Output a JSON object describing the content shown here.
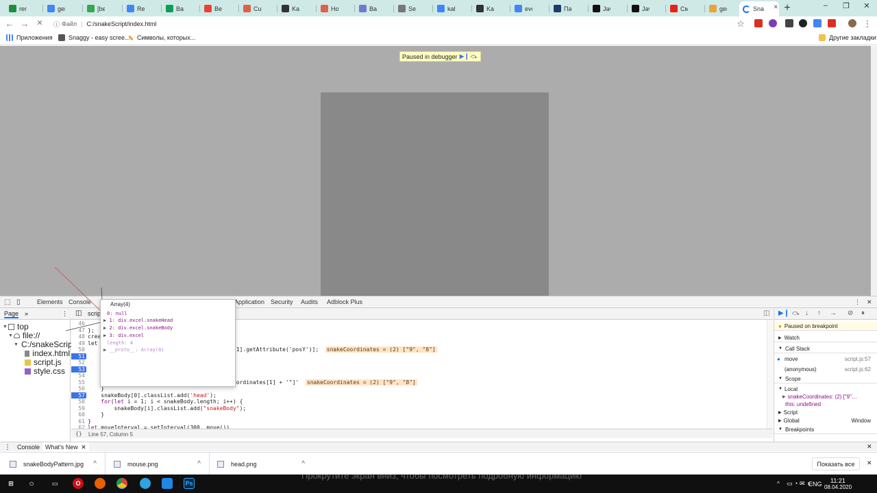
{
  "browser": {
    "tabs": [
      {
        "label": "rem",
        "color": "#1e8e3e"
      },
      {
        "label": "ger",
        "color": "#4285f4"
      },
      {
        "label": "[bet",
        "color": "#34a853"
      },
      {
        "label": "Rea",
        "color": "#4285f4"
      },
      {
        "label": "Bak",
        "color": "#0f9d58"
      },
      {
        "label": "Bes",
        "color": "#e94235"
      },
      {
        "label": "Cur",
        "color": "#e0604a"
      },
      {
        "label": "Kak",
        "color": "#333333"
      },
      {
        "label": "Hov",
        "color": "#e0604a"
      },
      {
        "label": "Bak",
        "color": "#6c7dd1"
      },
      {
        "label": "Ses",
        "color": "#777777"
      },
      {
        "label": "kak",
        "color": "#4285f4"
      },
      {
        "label": "Kak",
        "color": "#333333"
      },
      {
        "label": "eve",
        "color": "#4285f4"
      },
      {
        "label": "Пар",
        "color": "#1a3d6b"
      },
      {
        "label": "Jav",
        "color": "#111111"
      },
      {
        "label": "Jav",
        "color": "#111111"
      },
      {
        "label": "Сме",
        "color": "#e62117"
      },
      {
        "label": "gec",
        "color": "#e8a33d"
      }
    ],
    "active_tab": "Sna",
    "new_tab_symbol": "+",
    "window_controls": [
      "–",
      "❐",
      "✕"
    ],
    "address_prefix": "Файл",
    "address": "C:/snakeScript/index.html",
    "bookmarks": [
      {
        "label": "Приложения",
        "color": "#4285f4"
      },
      {
        "label": "Snaggy - easy scree...",
        "color": "#555555"
      },
      {
        "label": "Символы, которых...",
        "color": "#e8a33d"
      }
    ],
    "other_bookmarks": "Другие закладки"
  },
  "page": {
    "paused_banner": "Paused in debugger"
  },
  "devtools": {
    "tabs": [
      "Elements",
      "Console",
      "Application",
      "Security",
      "Audits",
      "Adblock Plus"
    ],
    "sources_sidebar_tabs": [
      "Page",
      "»"
    ],
    "open_file_tab": "scrip",
    "navigator": [
      {
        "label": "top",
        "indent": 0,
        "kind": "frame"
      },
      {
        "label": "file://",
        "indent": 1,
        "kind": "cloud"
      },
      {
        "label": "C:/snakeScript",
        "indent": 2,
        "kind": "folder"
      },
      {
        "label": "index.html",
        "indent": 3,
        "kind": "html"
      },
      {
        "label": "script.js",
        "indent": 3,
        "kind": "js"
      },
      {
        "label": "style.css",
        "indent": 3,
        "kind": "css"
      }
    ],
    "code_lines": [
      {
        "n": "46",
        "html": ""
      },
      {
        "n": "47",
        "html": "};"
      },
      {
        "n": "48",
        "html": "crea"
      },
      {
        "n": "49",
        "html": "let"
      },
      {
        "n": "50",
        "html": "                      ute('posX'), snakeBody[1].getAttribute('posY')];  <span class=\"inl\">snakeCoordinates = (2) [\"9\", \"8\"]</span>"
      },
      {
        "n": "51",
        "html": ""
      },
      {
        "n": "52",
        "html": "                      ove('snakeBody');"
      },
      {
        "n": "53",
        "html": ""
      },
      {
        "n": "54",
        "html": ""
      },
      {
        "n": "55",
        "html": "                      '\"][posY = \"' + snakeCoordinates[1] + '\"]'  <span class=\"inl\">snakeCoordinates = (2) [\"9\", \"8\"]</span>"
      },
      {
        "n": "56",
        "html": "    }"
      },
      {
        "n": "57",
        "html": "    snakeBody[0].classList.add(<span class=\"str\">'head'</span>);"
      },
      {
        "n": "58",
        "html": "    <span class=\"kw\">for</span>(<span class=\"kw\">let</span> i = 1; i &lt; snakeBody.length; i++) {"
      },
      {
        "n": "59",
        "html": "        snakeBody[i].classList.add(<span class=\"str\">\"snakeBody\"</span>);"
      },
      {
        "n": "60",
        "html": "    }"
      },
      {
        "n": "61",
        "html": "}"
      },
      {
        "n": "62",
        "html": "<span class=\"kw\">let</span> moveInterval = setInterval(300, move())"
      }
    ],
    "breakpoint_lines": [
      "51",
      "53",
      "57"
    ],
    "status": "Line 57, Column 5",
    "popover": {
      "title": "Array(4)",
      "entries": [
        "0: null",
        "1: div.excel.snakeHead",
        "2: div.excel.snakeBody",
        "3: div.excel"
      ],
      "length": "length: 4",
      "proto": "__proto__: Array(0)"
    },
    "debug": {
      "paused_on": "Paused on breakpoint",
      "watch": "Watch",
      "call_stack": "Call Stack",
      "frames": [
        {
          "fn": "move",
          "loc": "script.js:57"
        },
        {
          "fn": "(anonymous)",
          "loc": "script.js:62"
        }
      ],
      "scope": "Scope",
      "local": "Local",
      "local_entries": [
        "snakeCoordinates: (2) [\"9\"…",
        "this: undefined"
      ],
      "script": "Script",
      "global": "Global",
      "global_value": "Window",
      "breakpoints": "Breakpoints"
    },
    "drawer_tabs": [
      "Console",
      "What's New"
    ]
  },
  "downloads": {
    "items": [
      "snakeBodyPattern.jpg",
      "mouse.png",
      "head.png"
    ],
    "show_all": "Показать все"
  },
  "taskbar": {
    "language": "ENG",
    "time": "11:21",
    "date": "08.04.2020",
    "caption": "Прокрутите экран вниз, чтобы посмотреть подробную информацию"
  }
}
